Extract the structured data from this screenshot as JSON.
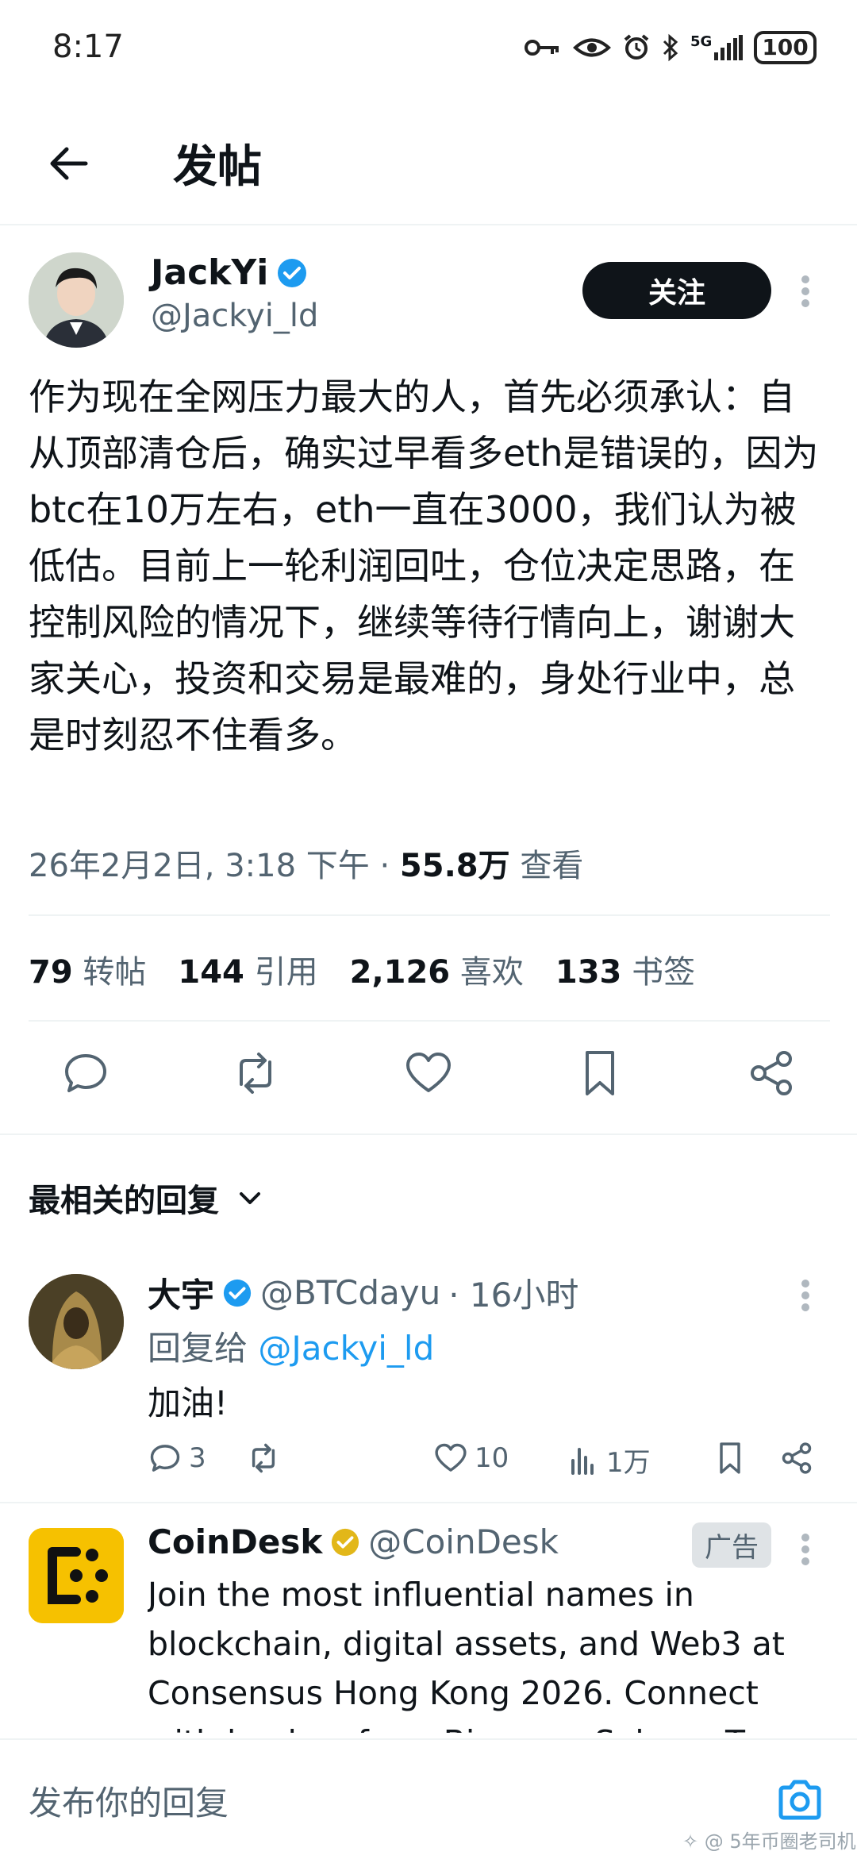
{
  "status_bar": {
    "time": "8:17",
    "network": "5G",
    "battery": "100"
  },
  "header": {
    "title": "发帖"
  },
  "post": {
    "author": "JackYi",
    "handle": "@Jackyi_ld",
    "follow_label": "关注",
    "text": "作为现在全网压力最大的人，首先必须承认：自从顶部清仓后，确实过早看多eth是错误的，因为btc在10万左右，eth一直在3000，我们认为被低估。目前上一轮利润回吐，仓位决定思路，在控制风险的情况下，继续等待行情向上，谢谢大家关心，投资和交易是最难的，身处行业中，总是时刻忍不住看多。",
    "date": "26年2月2日, 3:18 下午 · ",
    "views": "55.8万",
    "views_label": " 查看",
    "stats": [
      {
        "count": "79",
        "label": "转帖"
      },
      {
        "count": "144",
        "label": "引用"
      },
      {
        "count": "2,126",
        "label": "喜欢"
      },
      {
        "count": "133",
        "label": "书签"
      }
    ]
  },
  "replies_sort": {
    "label": "最相关的回复"
  },
  "reply": {
    "name": "大宇",
    "handle": "@BTCdayu",
    "time": "· 16小时",
    "reply_to_label": "回复给 ",
    "reply_to_handle": "@Jackyi_ld",
    "text": "加油!",
    "comments": "3",
    "likes": "10",
    "views": "1万"
  },
  "ad": {
    "name": "CoinDesk",
    "handle": "@CoinDesk",
    "badge": "广告",
    "text": "Join the most influential names in blockchain, digital assets, and Web3 at Consensus Hong Kong 2026. Connect with leaders from Binance, Solana, Tron"
  },
  "composer": {
    "placeholder": "发布你的回复"
  },
  "watermark": "✧ @ 5年币圈老司机",
  "colors": {
    "accent": "#1d9bf0",
    "text": "#0f1419",
    "muted": "#536471",
    "gold": "#e2b719"
  }
}
